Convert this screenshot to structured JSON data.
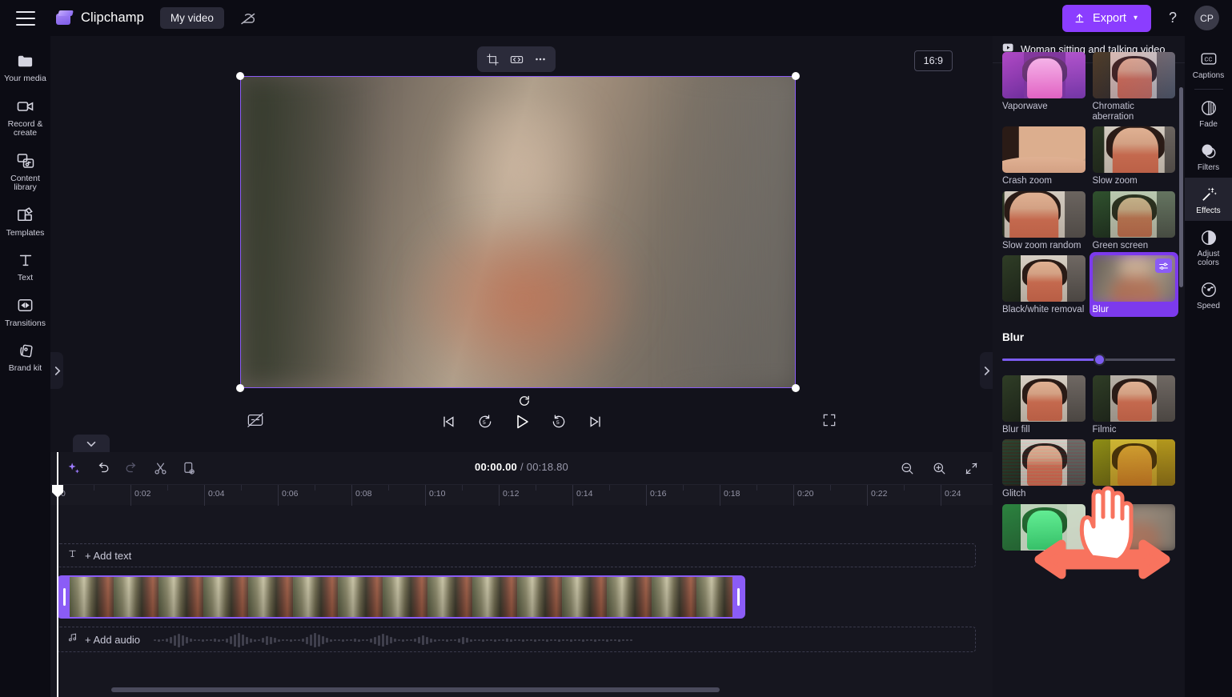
{
  "topbar": {
    "menu_icon": "hamburger-icon",
    "brand": "Clipchamp",
    "project_name": "My video",
    "cloud_icon": "cloud-off-icon",
    "export_label": "Export",
    "export_chevron": "⌄",
    "help_label": "?",
    "avatar_initials": "CP",
    "accent_color": "#8b3dff"
  },
  "left_rail": {
    "items": [
      {
        "label": "Your media",
        "icon": "folder-icon"
      },
      {
        "label": "Record &\ncreate",
        "icon": "video-camera-icon"
      },
      {
        "label": "Content\nlibrary",
        "icon": "content-library-icon"
      },
      {
        "label": "Templates",
        "icon": "templates-icon"
      },
      {
        "label": "Text",
        "icon": "text-icon"
      },
      {
        "label": "Transitions",
        "icon": "transitions-icon"
      },
      {
        "label": "Brand kit",
        "icon": "brand-kit-icon"
      }
    ],
    "collapse_icon": "chevron-right-icon"
  },
  "preview": {
    "float_tools": [
      {
        "name": "crop-tool",
        "icon": "crop-icon"
      },
      {
        "name": "fit-tool",
        "icon": "fit-arrows-icon"
      },
      {
        "name": "more-tool",
        "icon": "ellipsis-icon"
      }
    ],
    "aspect_ratio": "16:9",
    "reload_icon": "reload-icon",
    "captions_toggle_icon": "captions-off-icon",
    "fullscreen_icon": "fullscreen-icon",
    "controls": [
      {
        "name": "skip-back-button",
        "icon": "skip-previous-icon"
      },
      {
        "name": "rewind-5-button",
        "icon": "rewind-5-icon"
      },
      {
        "name": "play-button",
        "icon": "play-icon"
      },
      {
        "name": "forward-5-button",
        "icon": "forward-5-icon"
      },
      {
        "name": "skip-forward-button",
        "icon": "skip-next-icon"
      }
    ],
    "panel_collapse_icon": "chevron-right-icon",
    "timeline_collapse_icon": "chevron-down-icon"
  },
  "timeline": {
    "toolbar": [
      {
        "name": "magic-tools-button",
        "icon": "sparkle-icon"
      },
      {
        "name": "undo-button",
        "icon": "undo-icon"
      },
      {
        "name": "redo-button",
        "icon": "redo-icon"
      },
      {
        "name": "split-button",
        "icon": "scissors-icon"
      },
      {
        "name": "duplicate-button",
        "icon": "duplicate-icon"
      }
    ],
    "current_time": "00:00.00",
    "separator": "/",
    "total_time": "00:18.80",
    "zoom_out_icon": "zoom-out-icon",
    "zoom_in_icon": "zoom-in-icon",
    "fit_icon": "fit-timeline-icon",
    "ruler_labels": [
      "0",
      "0:02",
      "0:04",
      "0:06",
      "0:08",
      "0:10",
      "0:12",
      "0:14",
      "0:16",
      "0:18",
      "0:20",
      "0:22",
      "0:24"
    ],
    "text_track_label": "+ Add text",
    "text_track_icon": "text-icon",
    "audio_track_label": "+ Add audio",
    "audio_track_icon": "music-note-icon"
  },
  "effects_panel": {
    "header_icon": "video-clip-icon",
    "header_title": "Woman sitting and talking video",
    "effects": [
      {
        "label": "Vaporwave",
        "style": "vapor",
        "selected": false
      },
      {
        "label": "Chromatic aberration",
        "style": "chroma",
        "selected": false
      },
      {
        "label": "Crash zoom",
        "style": "crash",
        "selected": false
      },
      {
        "label": "Slow zoom",
        "style": "slowzoom",
        "selected": false
      },
      {
        "label": "Slow zoom random",
        "style": "slowzoomrand",
        "selected": false
      },
      {
        "label": "Green screen",
        "style": "greenscreen",
        "selected": false
      },
      {
        "label": "Black/white removal",
        "style": "bwremoval",
        "selected": false
      },
      {
        "label": "Blur",
        "style": "blur",
        "selected": true
      }
    ],
    "effects_row2": [
      {
        "label": "Blur fill",
        "style": "blurfill",
        "selected": false
      },
      {
        "label": "Filmic",
        "style": "filmic",
        "selected": false
      },
      {
        "label": "Glitch",
        "style": "glitch",
        "selected": false
      },
      {
        "label": "Disco",
        "style": "disco",
        "selected": false
      }
    ],
    "settings_chip_icon": "sliders-icon",
    "slider": {
      "title": "Blur",
      "value_percent": 56
    }
  },
  "right_rail": {
    "items": [
      {
        "label": "Captions",
        "icon": "closed-captions-icon",
        "active": false
      },
      {
        "label": "Fade",
        "icon": "fade-icon",
        "active": false
      },
      {
        "label": "Filters",
        "icon": "filters-icon",
        "active": false
      },
      {
        "label": "Effects",
        "icon": "effects-wand-icon",
        "active": true
      },
      {
        "label": "Adjust colors",
        "icon": "adjust-colors-icon",
        "active": false
      },
      {
        "label": "Speed",
        "icon": "speedometer-icon",
        "active": false
      }
    ]
  },
  "annotation": {
    "cursor_icon": "hand-cursor-icon",
    "arrow_icon": "double-arrow-horizontal-icon",
    "arrow_color": "#f8735e"
  }
}
